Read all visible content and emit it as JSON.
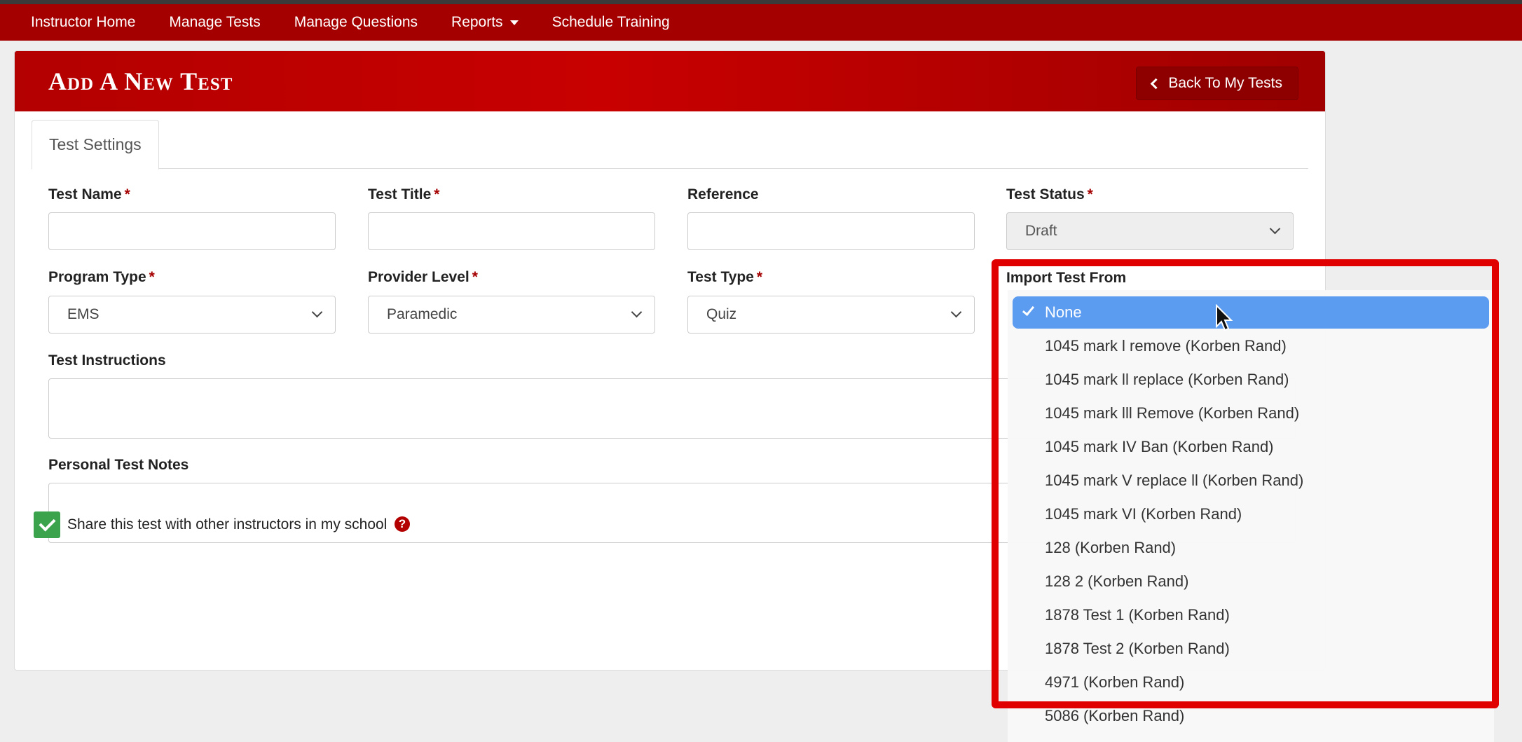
{
  "nav": {
    "items": [
      {
        "label": "Instructor Home"
      },
      {
        "label": "Manage Tests"
      },
      {
        "label": "Manage Questions"
      },
      {
        "label": "Reports"
      },
      {
        "label": "Schedule Training"
      }
    ]
  },
  "header": {
    "title": "Add A New Test",
    "back_label": "Back To My Tests"
  },
  "tabs": [
    {
      "label": "Test Settings"
    }
  ],
  "form": {
    "required_marker": "*",
    "test_name": {
      "label": "Test Name",
      "value": ""
    },
    "test_title": {
      "label": "Test Title",
      "value": ""
    },
    "reference": {
      "label": "Reference",
      "value": ""
    },
    "test_status": {
      "label": "Test Status",
      "value": "Draft"
    },
    "program_type": {
      "label": "Program Type",
      "value": "EMS"
    },
    "provider_level": {
      "label": "Provider Level",
      "value": "Paramedic"
    },
    "test_type": {
      "label": "Test Type",
      "value": "Quiz"
    },
    "import_from": {
      "label": "Import Test From",
      "selected": "None",
      "options": [
        "None",
        "1045 mark l remove (Korben Rand)",
        "1045 mark ll replace (Korben Rand)",
        "1045 mark lll Remove (Korben Rand)",
        "1045 mark IV Ban (Korben Rand)",
        "1045 mark V replace ll (Korben Rand)",
        "1045 mark VI (Korben Rand)",
        "128 (Korben Rand)",
        "128 2 (Korben Rand)",
        "1878 Test 1 (Korben Rand)",
        "1878 Test 2 (Korben Rand)",
        "4971 (Korben Rand)",
        "5086 (Korben Rand)"
      ]
    },
    "instructions": {
      "label": "Test Instructions",
      "value": ""
    },
    "notes": {
      "label": "Personal Test Notes",
      "value": ""
    },
    "share": {
      "label": "Share this test with other instructors in my school",
      "checked": true,
      "help_glyph": "?"
    }
  },
  "icons": [
    "caret-down-icon",
    "chevron-left-icon",
    "chevron-down-icon",
    "check-icon",
    "help-icon",
    "mouse-cursor-icon"
  ],
  "colors": {
    "brand_red": "#a50000",
    "highlight_red": "#e00000",
    "select_blue": "#5b9bf0",
    "check_green": "#3aa34b"
  }
}
